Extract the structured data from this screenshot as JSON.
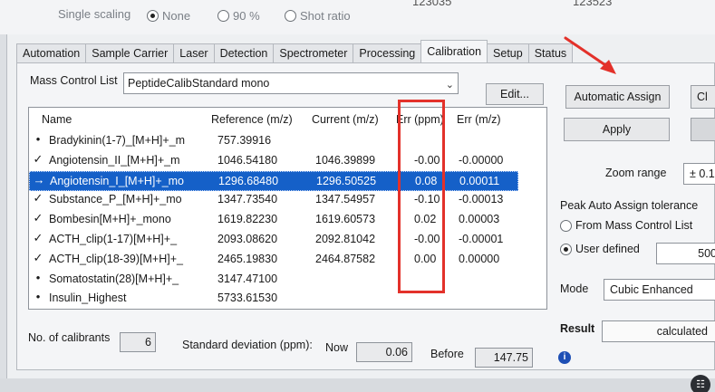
{
  "top_bar": {
    "label": "Single scaling",
    "options": [
      {
        "label": "None",
        "checked": true
      },
      {
        "label": "90 %",
        "checked": false
      },
      {
        "label": "Shot ratio",
        "checked": false
      }
    ],
    "partial_values": [
      "123035",
      "123523"
    ]
  },
  "tabs": [
    {
      "label": "Automation",
      "active": false
    },
    {
      "label": "Sample Carrier",
      "active": false
    },
    {
      "label": "Laser",
      "active": false
    },
    {
      "label": "Detection",
      "active": false
    },
    {
      "label": "Spectrometer",
      "active": false
    },
    {
      "label": "Processing",
      "active": false
    },
    {
      "label": "Calibration",
      "active": true
    },
    {
      "label": "Setup",
      "active": false
    },
    {
      "label": "Status",
      "active": false
    }
  ],
  "mass_control": {
    "label": "Mass Control List",
    "selected": "PeptideCalibStandard mono",
    "edit_label": "Edit..."
  },
  "table": {
    "headers": {
      "name": "Name",
      "reference": "Reference (m/z)",
      "current": "Current (m/z)",
      "err_ppm": "Err (ppm)",
      "err_mz": "Err (m/z)"
    },
    "rows": [
      {
        "mark": "•",
        "name": "Bradykinin(1-7)_[M+H]+_m",
        "reference": "757.39916",
        "current": "",
        "err_ppm": "",
        "err_mz": "",
        "selected": false
      },
      {
        "mark": "✓",
        "name": "Angiotensin_II_[M+H]+_m",
        "reference": "1046.54180",
        "current": "1046.39899",
        "err_ppm": "-0.00",
        "err_mz": "-0.00000",
        "selected": false
      },
      {
        "mark": "→",
        "name": "Angiotensin_I_[M+H]+_mo",
        "reference": "1296.68480",
        "current": "1296.50525",
        "err_ppm": "0.08",
        "err_mz": "0.00011",
        "selected": true
      },
      {
        "mark": "✓",
        "name": "Substance_P_[M+H]+_mo",
        "reference": "1347.73540",
        "current": "1347.54957",
        "err_ppm": "-0.10",
        "err_mz": "-0.00013",
        "selected": false
      },
      {
        "mark": "✓",
        "name": "Bombesin[M+H]+_mono",
        "reference": "1619.82230",
        "current": "1619.60573",
        "err_ppm": "0.02",
        "err_mz": "0.00003",
        "selected": false
      },
      {
        "mark": "✓",
        "name": "ACTH_clip(1-17)[M+H]+_",
        "reference": "2093.08620",
        "current": "2092.81042",
        "err_ppm": "-0.00",
        "err_mz": "-0.00001",
        "selected": false
      },
      {
        "mark": "✓",
        "name": "ACTH_clip(18-39)[M+H]+_",
        "reference": "2465.19830",
        "current": "2464.87582",
        "err_ppm": "0.00",
        "err_mz": "0.00000",
        "selected": false
      },
      {
        "mark": "•",
        "name": "Somatostatin(28)[M+H]+_",
        "reference": "3147.47100",
        "current": "",
        "err_ppm": "",
        "err_mz": "",
        "selected": false
      },
      {
        "mark": "•",
        "name": "Insulin_Highest",
        "reference": "5733.61530",
        "current": "",
        "err_ppm": "",
        "err_mz": "",
        "selected": false
      }
    ]
  },
  "stats": {
    "calibrants_label": "No. of calibrants",
    "calibrants_value": "6",
    "std_label": "Standard deviation (ppm):",
    "now_label": "Now",
    "now_value": "0.06",
    "before_label": "Before",
    "before_value": "147.75"
  },
  "right_panel": {
    "auto_assign_label": "Automatic Assign",
    "clear_partial": "Cl",
    "apply_label": "Apply",
    "zoom_label": "Zoom range",
    "zoom_value": "± 0.1",
    "tolerance_label": "Peak Auto Assign tolerance",
    "from_list_label": "From Mass Control List",
    "user_defined_label": "User defined",
    "user_defined_value": "500",
    "mode_label": "Mode",
    "mode_value": "Cubic Enhanced",
    "result_label": "Result",
    "result_value": "calculated"
  },
  "annotation": {
    "red_color": "#e3312a"
  }
}
